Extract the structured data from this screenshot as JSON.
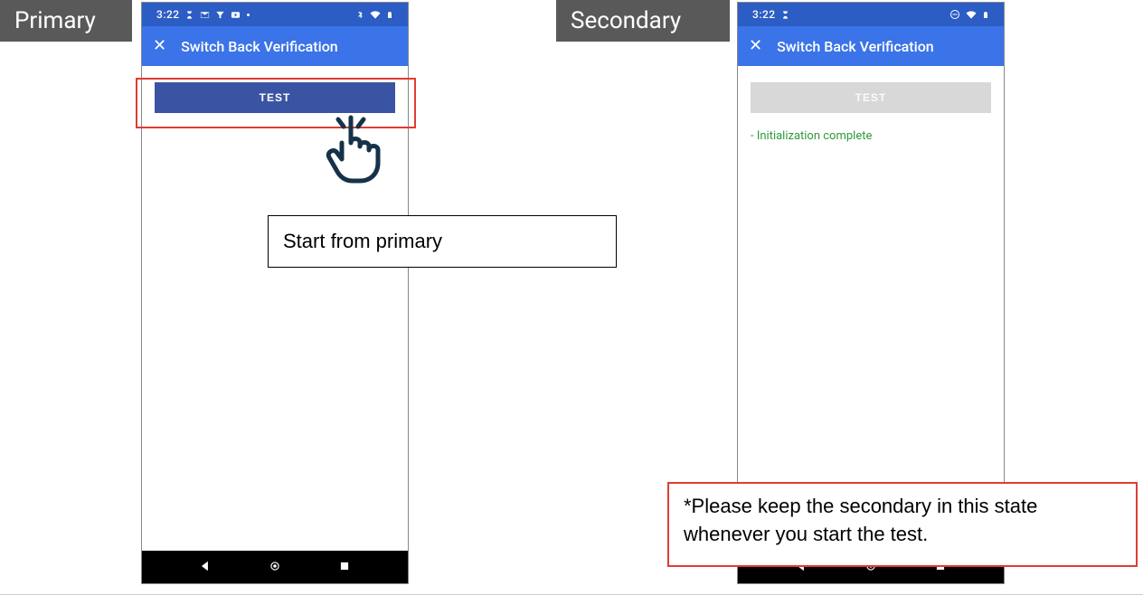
{
  "tags": {
    "primary": "Primary",
    "secondary": "Secondary"
  },
  "statusbar": {
    "time": "3:22"
  },
  "appbar": {
    "title": "Switch Back Verification"
  },
  "buttons": {
    "test_enabled": "TEST",
    "test_disabled": "TEST"
  },
  "secondary_status": "- Initialization complete",
  "notes": {
    "start": "Start from primary",
    "keep": "*Please keep the secondary in this state whenever you start the test."
  }
}
